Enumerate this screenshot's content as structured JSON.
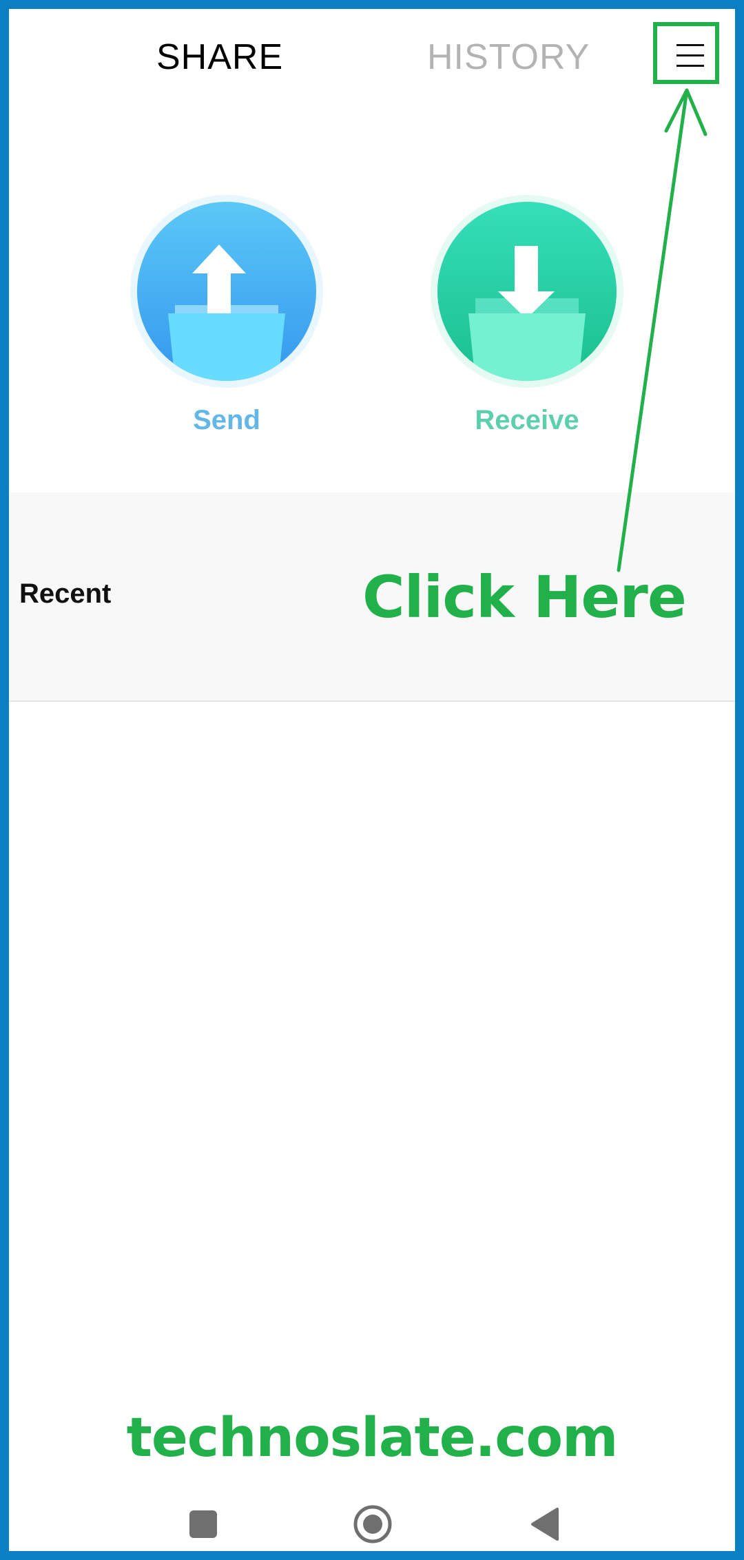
{
  "tabs": {
    "share_label": "SHARE",
    "history_label": "HISTORY"
  },
  "header": {
    "menu_icon": "hamburger-menu-icon"
  },
  "actions": {
    "send": {
      "label": "Send",
      "icon": "upload-folder-icon",
      "color": "#3598ee"
    },
    "receive": {
      "label": "Receive",
      "icon": "download-folder-icon",
      "color": "#1bbf8e"
    }
  },
  "recent": {
    "label": "Recent"
  },
  "annotation": {
    "text": "Click Here",
    "color": "#22b04b"
  },
  "watermark": {
    "text": "technoslate.com"
  },
  "navbar": {
    "items": [
      "square-recents-icon",
      "circle-home-icon",
      "triangle-back-icon"
    ]
  },
  "colors": {
    "frame": "#0a7fc4",
    "accent_green": "#22b04b"
  }
}
